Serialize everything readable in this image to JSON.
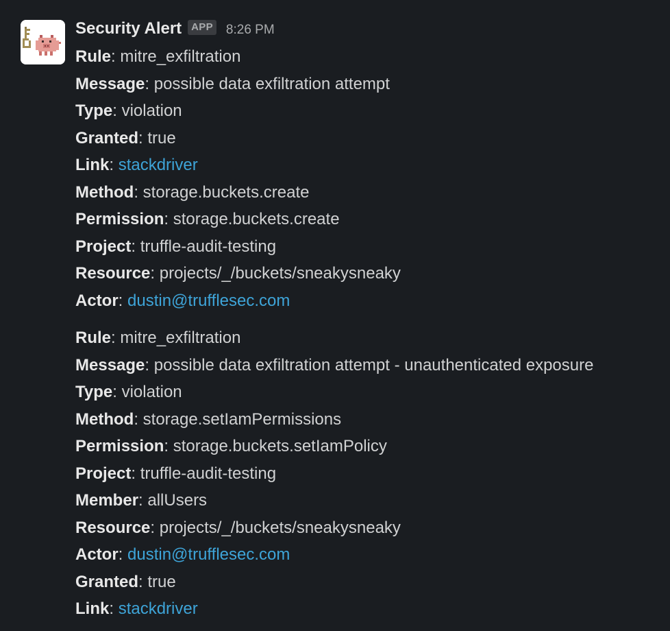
{
  "message": {
    "sender": "Security Alert",
    "badge": "APP",
    "time": "8:26 PM",
    "avatar_icon": "pig-and-key-icon"
  },
  "alerts": [
    {
      "lines": [
        {
          "key": "Rule",
          "sep": ": ",
          "value": "mitre_exfiltration",
          "link": false
        },
        {
          "key": "Message",
          "sep": ": ",
          "value": "possible data exfiltration attempt",
          "link": false
        },
        {
          "key": "Type",
          "sep": ": ",
          "value": "violation",
          "link": false
        },
        {
          "key": "Granted",
          "sep": ": ",
          "value": "true",
          "link": false
        },
        {
          "key": "Link",
          "sep": ": ",
          "value": "stackdriver",
          "link": true
        },
        {
          "key": "Method",
          "sep": ": ",
          "value": "storage.buckets.create",
          "link": false
        },
        {
          "key": "Permission",
          "sep": ": ",
          "value": "storage.buckets.create",
          "link": false
        },
        {
          "key": "Project",
          "sep": ": ",
          "value": "truffle-audit-testing",
          "link": false
        },
        {
          "key": "Resource",
          "sep": ": ",
          "value": "projects/_/buckets/sneakysneaky",
          "link": false
        },
        {
          "key": "Actor",
          "sep": ": ",
          "value": "dustin@trufflesec.com",
          "link": true
        }
      ]
    },
    {
      "lines": [
        {
          "key": "Rule",
          "sep": ": ",
          "value": "mitre_exfiltration",
          "link": false
        },
        {
          "key": "Message",
          "sep": ": ",
          "value": "possible data exfiltration attempt - unauthenticated exposure",
          "link": false
        },
        {
          "key": "Type",
          "sep": ": ",
          "value": "violation",
          "link": false
        },
        {
          "key": "Method",
          "sep": ": ",
          "value": "storage.setIamPermissions",
          "link": false
        },
        {
          "key": "Permission",
          "sep": ": ",
          "value": "storage.buckets.setIamPolicy",
          "link": false
        },
        {
          "key": "Project",
          "sep": ": ",
          "value": "truffle-audit-testing",
          "link": false
        },
        {
          "key": "Member",
          "sep": ": ",
          "value": "allUsers",
          "link": false
        },
        {
          "key": "Resource",
          "sep": ": ",
          "value": "projects/_/buckets/sneakysneaky",
          "link": false
        },
        {
          "key": "Actor",
          "sep": ": ",
          "value": "dustin@trufflesec.com",
          "link": true
        },
        {
          "key": "Granted",
          "sep": ": ",
          "value": "true",
          "link": false
        },
        {
          "key": "Link",
          "sep": ": ",
          "value": "stackdriver",
          "link": true
        }
      ]
    }
  ],
  "colors": {
    "background": "#1a1d21",
    "text": "#d1d2d3",
    "link": "#3ea4d8",
    "badge_bg": "#3a3c40"
  }
}
